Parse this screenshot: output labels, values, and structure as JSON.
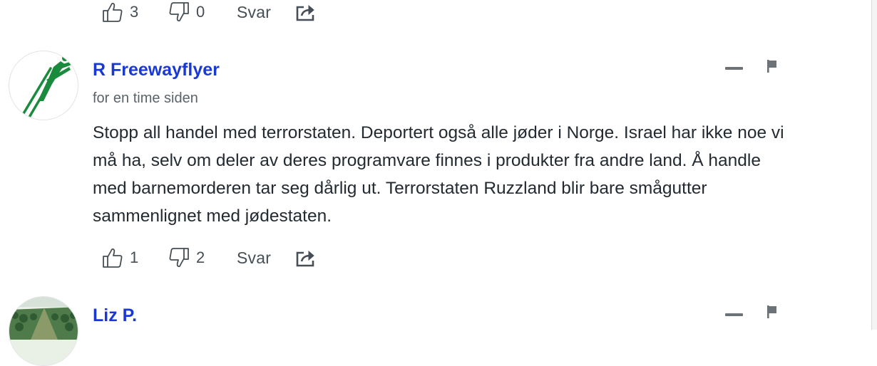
{
  "top_actions": {
    "likes": "3",
    "dislikes": "0",
    "reply_label": "Svar"
  },
  "comments": [
    {
      "author": "R Freewayflyer",
      "timestamp": "for en time siden",
      "body": "Stopp all handel med terrorstaten. Deportert også alle jøder i Norge. Israel har ikke noe vi må ha, selv om deler av deres programvare finnes i produkter fra andre land. Å handle med barnemorderen tar seg dårlig ut. Terrorstaten Ruzzland blir bare smågutter sammenlignet med jødestaten.",
      "likes": "1",
      "dislikes": "2",
      "reply_label": "Svar"
    },
    {
      "author": "Liz P."
    }
  ],
  "colors": {
    "author_link": "#1a39d4",
    "icon": "#464e56",
    "avatar_green": "#1a8a3c"
  },
  "icons": [
    "thumbs-up-icon",
    "thumbs-down-icon",
    "share-icon",
    "collapse-icon",
    "flag-icon"
  ]
}
